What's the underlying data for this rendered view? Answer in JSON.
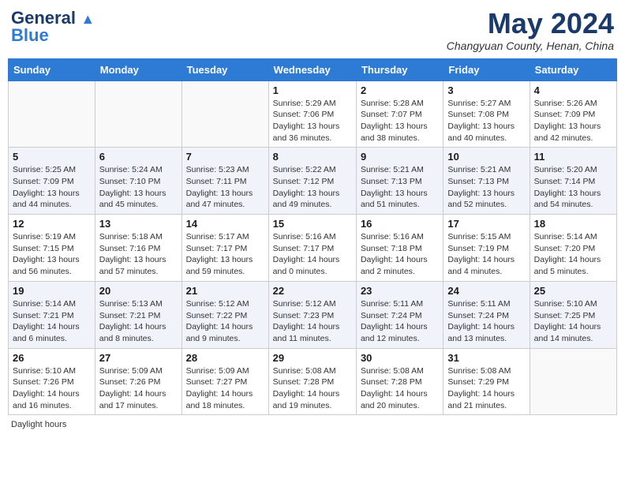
{
  "header": {
    "logo_line1": "General",
    "logo_line2": "Blue",
    "month_title": "May 2024",
    "subtitle": "Changyuan County, Henan, China"
  },
  "days_of_week": [
    "Sunday",
    "Monday",
    "Tuesday",
    "Wednesday",
    "Thursday",
    "Friday",
    "Saturday"
  ],
  "weeks": [
    [
      {
        "day": "",
        "sunrise": "",
        "sunset": "",
        "daylight": ""
      },
      {
        "day": "",
        "sunrise": "",
        "sunset": "",
        "daylight": ""
      },
      {
        "day": "",
        "sunrise": "",
        "sunset": "",
        "daylight": ""
      },
      {
        "day": "1",
        "sunrise": "Sunrise: 5:29 AM",
        "sunset": "Sunset: 7:06 PM",
        "daylight": "Daylight: 13 hours and 36 minutes."
      },
      {
        "day": "2",
        "sunrise": "Sunrise: 5:28 AM",
        "sunset": "Sunset: 7:07 PM",
        "daylight": "Daylight: 13 hours and 38 minutes."
      },
      {
        "day": "3",
        "sunrise": "Sunrise: 5:27 AM",
        "sunset": "Sunset: 7:08 PM",
        "daylight": "Daylight: 13 hours and 40 minutes."
      },
      {
        "day": "4",
        "sunrise": "Sunrise: 5:26 AM",
        "sunset": "Sunset: 7:09 PM",
        "daylight": "Daylight: 13 hours and 42 minutes."
      }
    ],
    [
      {
        "day": "5",
        "sunrise": "Sunrise: 5:25 AM",
        "sunset": "Sunset: 7:09 PM",
        "daylight": "Daylight: 13 hours and 44 minutes."
      },
      {
        "day": "6",
        "sunrise": "Sunrise: 5:24 AM",
        "sunset": "Sunset: 7:10 PM",
        "daylight": "Daylight: 13 hours and 45 minutes."
      },
      {
        "day": "7",
        "sunrise": "Sunrise: 5:23 AM",
        "sunset": "Sunset: 7:11 PM",
        "daylight": "Daylight: 13 hours and 47 minutes."
      },
      {
        "day": "8",
        "sunrise": "Sunrise: 5:22 AM",
        "sunset": "Sunset: 7:12 PM",
        "daylight": "Daylight: 13 hours and 49 minutes."
      },
      {
        "day": "9",
        "sunrise": "Sunrise: 5:21 AM",
        "sunset": "Sunset: 7:13 PM",
        "daylight": "Daylight: 13 hours and 51 minutes."
      },
      {
        "day": "10",
        "sunrise": "Sunrise: 5:21 AM",
        "sunset": "Sunset: 7:13 PM",
        "daylight": "Daylight: 13 hours and 52 minutes."
      },
      {
        "day": "11",
        "sunrise": "Sunrise: 5:20 AM",
        "sunset": "Sunset: 7:14 PM",
        "daylight": "Daylight: 13 hours and 54 minutes."
      }
    ],
    [
      {
        "day": "12",
        "sunrise": "Sunrise: 5:19 AM",
        "sunset": "Sunset: 7:15 PM",
        "daylight": "Daylight: 13 hours and 56 minutes."
      },
      {
        "day": "13",
        "sunrise": "Sunrise: 5:18 AM",
        "sunset": "Sunset: 7:16 PM",
        "daylight": "Daylight: 13 hours and 57 minutes."
      },
      {
        "day": "14",
        "sunrise": "Sunrise: 5:17 AM",
        "sunset": "Sunset: 7:17 PM",
        "daylight": "Daylight: 13 hours and 59 minutes."
      },
      {
        "day": "15",
        "sunrise": "Sunrise: 5:16 AM",
        "sunset": "Sunset: 7:17 PM",
        "daylight": "Daylight: 14 hours and 0 minutes."
      },
      {
        "day": "16",
        "sunrise": "Sunrise: 5:16 AM",
        "sunset": "Sunset: 7:18 PM",
        "daylight": "Daylight: 14 hours and 2 minutes."
      },
      {
        "day": "17",
        "sunrise": "Sunrise: 5:15 AM",
        "sunset": "Sunset: 7:19 PM",
        "daylight": "Daylight: 14 hours and 4 minutes."
      },
      {
        "day": "18",
        "sunrise": "Sunrise: 5:14 AM",
        "sunset": "Sunset: 7:20 PM",
        "daylight": "Daylight: 14 hours and 5 minutes."
      }
    ],
    [
      {
        "day": "19",
        "sunrise": "Sunrise: 5:14 AM",
        "sunset": "Sunset: 7:21 PM",
        "daylight": "Daylight: 14 hours and 6 minutes."
      },
      {
        "day": "20",
        "sunrise": "Sunrise: 5:13 AM",
        "sunset": "Sunset: 7:21 PM",
        "daylight": "Daylight: 14 hours and 8 minutes."
      },
      {
        "day": "21",
        "sunrise": "Sunrise: 5:12 AM",
        "sunset": "Sunset: 7:22 PM",
        "daylight": "Daylight: 14 hours and 9 minutes."
      },
      {
        "day": "22",
        "sunrise": "Sunrise: 5:12 AM",
        "sunset": "Sunset: 7:23 PM",
        "daylight": "Daylight: 14 hours and 11 minutes."
      },
      {
        "day": "23",
        "sunrise": "Sunrise: 5:11 AM",
        "sunset": "Sunset: 7:24 PM",
        "daylight": "Daylight: 14 hours and 12 minutes."
      },
      {
        "day": "24",
        "sunrise": "Sunrise: 5:11 AM",
        "sunset": "Sunset: 7:24 PM",
        "daylight": "Daylight: 14 hours and 13 minutes."
      },
      {
        "day": "25",
        "sunrise": "Sunrise: 5:10 AM",
        "sunset": "Sunset: 7:25 PM",
        "daylight": "Daylight: 14 hours and 14 minutes."
      }
    ],
    [
      {
        "day": "26",
        "sunrise": "Sunrise: 5:10 AM",
        "sunset": "Sunset: 7:26 PM",
        "daylight": "Daylight: 14 hours and 16 minutes."
      },
      {
        "day": "27",
        "sunrise": "Sunrise: 5:09 AM",
        "sunset": "Sunset: 7:26 PM",
        "daylight": "Daylight: 14 hours and 17 minutes."
      },
      {
        "day": "28",
        "sunrise": "Sunrise: 5:09 AM",
        "sunset": "Sunset: 7:27 PM",
        "daylight": "Daylight: 14 hours and 18 minutes."
      },
      {
        "day": "29",
        "sunrise": "Sunrise: 5:08 AM",
        "sunset": "Sunset: 7:28 PM",
        "daylight": "Daylight: 14 hours and 19 minutes."
      },
      {
        "day": "30",
        "sunrise": "Sunrise: 5:08 AM",
        "sunset": "Sunset: 7:28 PM",
        "daylight": "Daylight: 14 hours and 20 minutes."
      },
      {
        "day": "31",
        "sunrise": "Sunrise: 5:08 AM",
        "sunset": "Sunset: 7:29 PM",
        "daylight": "Daylight: 14 hours and 21 minutes."
      },
      {
        "day": "",
        "sunrise": "",
        "sunset": "",
        "daylight": ""
      }
    ]
  ],
  "footer": {
    "daylight_label": "Daylight hours"
  }
}
